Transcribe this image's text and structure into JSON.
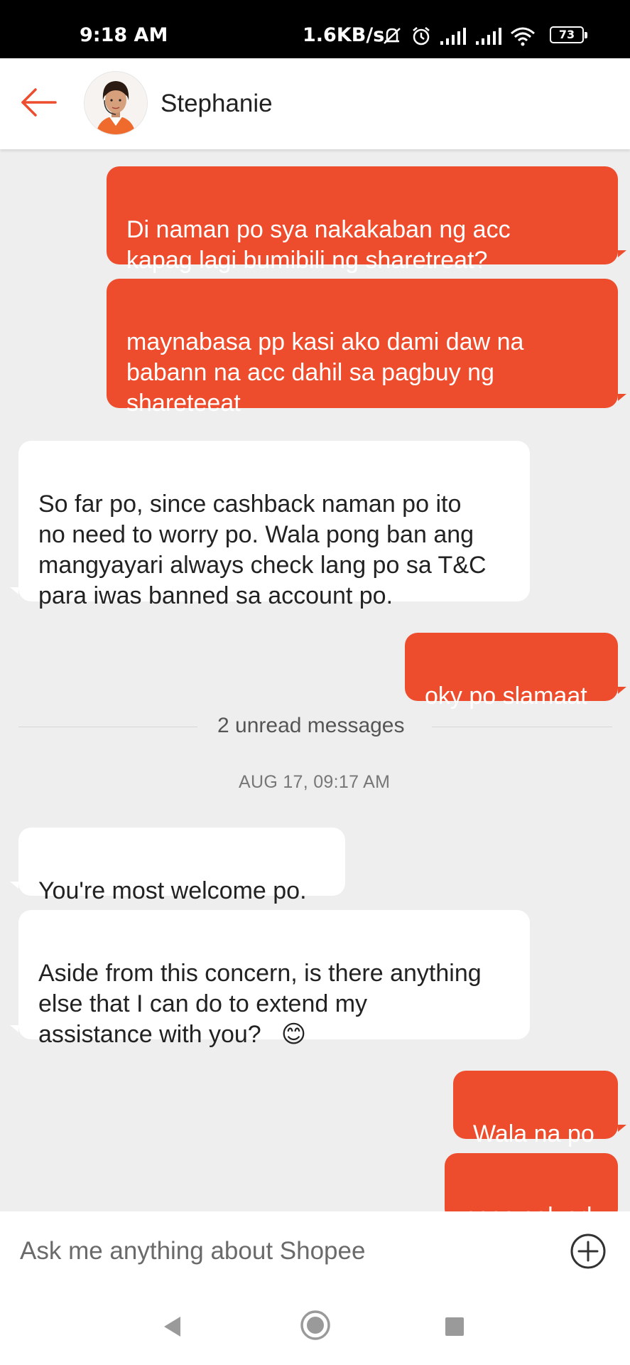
{
  "status_bar": {
    "time": "9:18 AM",
    "network_speed": "1.6KB/s",
    "battery_level": "73",
    "icons": [
      "mute-icon",
      "alarm-icon",
      "signal-icon",
      "signal-icon",
      "wifi-icon",
      "battery-icon"
    ]
  },
  "header": {
    "agent_name": "Stephanie",
    "back_icon": "arrow-left-icon"
  },
  "messages": [
    {
      "from": "user",
      "text": "Di naman po sya nakakaban ng acc\nkapag lagi bumibili ng sharetreat?"
    },
    {
      "from": "user",
      "text": "maynabasa pp kasi ako dami daw na\nbabann na acc dahil sa pagbuy ng\nshareteeat"
    },
    {
      "from": "agent",
      "text": "So far po, since cashback naman po ito\nno need to worry po. Wala pong ban ang\nmangyayari always check lang po sa T&C\npara iwas banned sa account po."
    },
    {
      "from": "user",
      "text": "oky po slamaat"
    },
    {
      "from": "agent",
      "text": "You're most welcome po."
    },
    {
      "from": "agent",
      "text": "Aside from this concern, is there anything\nelse that I can do to extend my\nassistance with you?",
      "emoji": "😊"
    },
    {
      "from": "user",
      "text": "Wala na po"
    },
    {
      "from": "user",
      "text": "case solved"
    }
  ],
  "unread_divider": "2 unread messages",
  "timestamp": "AUG 17, 09:17 AM",
  "input": {
    "placeholder": "Ask me anything about Shopee"
  },
  "colors": {
    "accent": "#ee4d2d",
    "background": "#eeeeee",
    "incoming_bubble": "#ffffff"
  }
}
